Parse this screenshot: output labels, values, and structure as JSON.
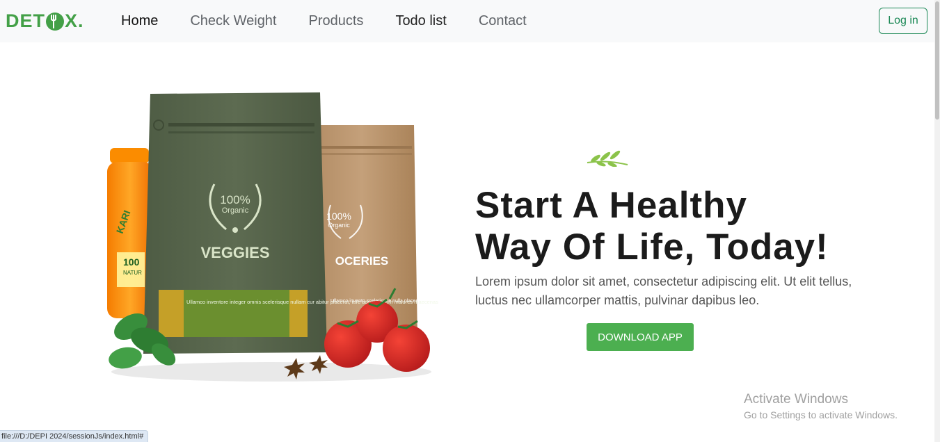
{
  "brand": {
    "name_left": "DET",
    "name_right": "X.",
    "logo_color": "#43a047"
  },
  "nav": {
    "items": [
      {
        "label": "Home",
        "state": "active"
      },
      {
        "label": "Check Weight",
        "state": "normal"
      },
      {
        "label": "Products",
        "state": "normal"
      },
      {
        "label": "Todo list",
        "state": "dark"
      },
      {
        "label": "Contact",
        "state": "normal"
      }
    ],
    "login_label": "Log in"
  },
  "hero": {
    "title_line1": "Start A Healthy",
    "title_line2": "Way Of Life, Today!",
    "description": "Lorem ipsum dolor sit amet, consectetur adipiscing elit. Ut elit tellus, luctus nec ullamcorper mattis, pulvinar dapibus leo.",
    "cta_label": "DOWNLOAD APP",
    "cta_color": "#4caf50",
    "image": {
      "bag1_badge_top": "100%",
      "bag1_badge_bottom": "Organic",
      "bag1_label": "VEGGIES",
      "bag1_blurb": "Ullamco inventore integer omnis scelerisque nullam cur abitur placerat, iure accus antium maiores maecenas",
      "bag2_badge_top": "100%",
      "bag2_badge_bottom": "Organic",
      "bag2_label": "OCERIES",
      "bag2_blurb": "Ullamco invento scelerisque nulla placerat, iure",
      "jar_label_1": "KARI",
      "jar_label_2": "100",
      "jar_label_3": "NATUR"
    }
  },
  "watermark": {
    "title": "Activate Windows",
    "subtitle": "Go to Settings to activate Windows."
  },
  "status_bar": {
    "url": "file:///D:/DEPI 2024/sessionJs/index.html#"
  }
}
